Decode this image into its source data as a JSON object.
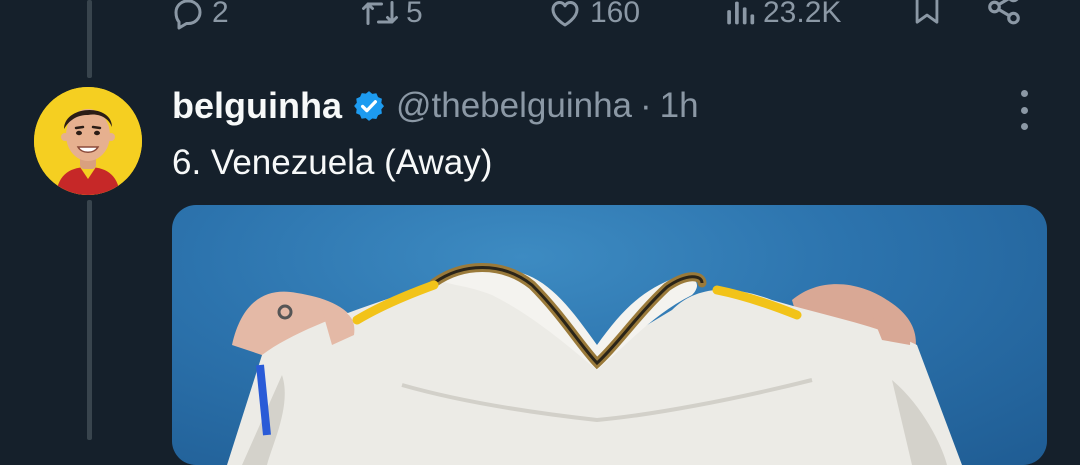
{
  "actions": {
    "reply_count": "2",
    "retweet_count": "5",
    "like_count": "160",
    "view_count": "23.2K",
    "icons": [
      "reply-icon",
      "retweet-icon",
      "like-icon",
      "views-icon",
      "bookmark-icon",
      "share-icon"
    ]
  },
  "tweet": {
    "display_name": "belguinha",
    "handle": "@thebelguinha",
    "separator": "·",
    "time": "1h",
    "text": "6. Venezuela (Away)"
  },
  "colors": {
    "background": "#15202b",
    "muted": "#8b98a5",
    "verified": "#1d9bf0",
    "avatar_bg": "#f5cf21",
    "media_sky": "#2c73ad"
  }
}
